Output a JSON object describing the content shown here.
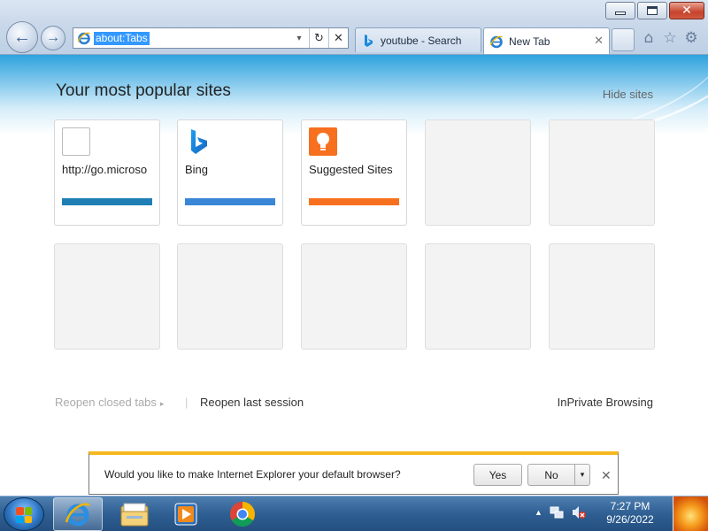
{
  "window": {
    "minimize_glyph": "",
    "close_glyph": "✕"
  },
  "nav": {
    "back_glyph": "←",
    "forward_glyph": "→"
  },
  "address": {
    "url": "about:Tabs",
    "dropdown_glyph": "▾",
    "refresh_glyph": "↻",
    "stop_glyph": "✕"
  },
  "tabs": [
    {
      "label": "youtube - Search",
      "icon": "bing-icon"
    },
    {
      "label": "New Tab",
      "icon": "ie-icon",
      "close_glyph": "✕"
    }
  ],
  "toolbar": {
    "home_glyph": "⌂",
    "favorites_glyph": "☆",
    "tools_glyph": "⚙"
  },
  "content": {
    "title": "Your most popular sites",
    "hide_sites": "Hide sites",
    "tiles": [
      {
        "label": "http://go.microso",
        "icon": "blank-page-icon",
        "bar_color": "#1f7fb5"
      },
      {
        "label": "Bing",
        "icon": "bing-logo-icon",
        "bar_color": "#3a86d6"
      },
      {
        "label": "Suggested Sites",
        "icon": "lightbulb-icon",
        "bar_color": "#f7701f"
      }
    ],
    "reopen_closed_tabs": "Reopen closed tabs",
    "reopen_closed_arrow": "▸",
    "separator": "|",
    "reopen_last_session": "Reopen last session",
    "inprivate_browsing": "InPrivate Browsing"
  },
  "notification": {
    "message": "Would you like to make Internet Explorer your default browser?",
    "yes_label": "Yes",
    "no_label": "No",
    "no_arrow": "▾",
    "close_glyph": "✕"
  },
  "taskbar": {
    "items": [
      "start-button",
      "internet-explorer",
      "windows-explorer",
      "windows-media-player",
      "google-chrome"
    ],
    "active": "internet-explorer",
    "tray_arrow": "▲",
    "time": "7:27 PM",
    "date": "9/26/2022"
  },
  "colors": {
    "accent": "#2fa3de",
    "notification_stripe": "#f6b820",
    "taskbar": "#2f5f93"
  }
}
